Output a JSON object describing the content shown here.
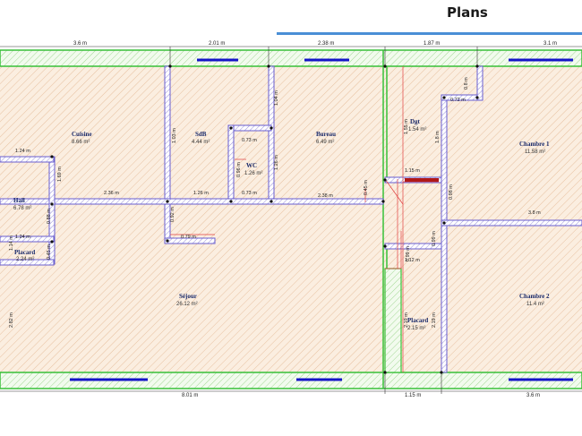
{
  "header": {
    "title": "Plans"
  },
  "top_dims": [
    "3.6 m",
    "2.01 m",
    "2.38 m",
    "1.87 m",
    "3.1 m"
  ],
  "bottom_dims": [
    "8.01 m",
    "1.15 m",
    "3.6 m"
  ],
  "rooms": [
    {
      "name": "Cuisine",
      "area": "8.66 m²"
    },
    {
      "name": "SdB",
      "area": "4.44 m²"
    },
    {
      "name": "Bureau",
      "area": "6.49 m²"
    },
    {
      "name": "WC",
      "area": "1.26 m²"
    },
    {
      "name": "Hall",
      "area": "6.78 m²"
    },
    {
      "name": "Placard",
      "area": "2.24 m²"
    },
    {
      "name": "Séjour",
      "area": "26.12 m²"
    },
    {
      "name": "Placard",
      "area": "2.15 m²"
    },
    {
      "name": "Chambre 1",
      "area": "11.58 m²"
    },
    {
      "name": "Chambre 2",
      "area": "11.4 m²"
    },
    {
      "name": "Dgt",
      "area": "1.54 m²"
    }
  ],
  "inner_dims": {
    "hall_top": "1.24 m",
    "hall_bottom": "1.24 m",
    "cuisine_width": "2.36 m",
    "sdb_width": "1.26 m",
    "wc_top": "0.73 m",
    "wc_bottom": "0.73 m",
    "wc_height": "1.36 m",
    "bureau_width": "2.38 m",
    "sdb_step": "0.79 m",
    "dgt_width": "1.15 m",
    "dgt_small": "0.72 m",
    "ch_top": "0.8 m",
    "chambre_wall": "3.8 m",
    "door_a": "1.12 m",
    "v_cuisine": "1.69 m",
    "v_sdb": "1.03 m",
    "v_wc": "0.96 m",
    "v_bureau": "1.04 m",
    "v_bureau2": "0.45 m",
    "v_hall": "0.88 m",
    "v_plac": "0.45 m",
    "v_hall2": "1.14 m",
    "v_sdb2": "0.92 m",
    "v_sejour": "2.82 m",
    "v_dgt1": "1.55 m",
    "v_dgt2": "1.8 m",
    "v_dgt3": "0.99 m",
    "v_dgt4": "0.99 m",
    "v_dgt5": "0.98 m",
    "v_plac2a": "2.19 m",
    "v_plac2b": "2.19 m",
    "v_wc2": "1.26 m"
  },
  "colors": {
    "room_fill": "#fbeee0",
    "hatch": "#e6b08a",
    "wall_purple": "#7b6fd0",
    "green": "#38c038",
    "window": "#1414c8",
    "red_line": "#e04040"
  }
}
